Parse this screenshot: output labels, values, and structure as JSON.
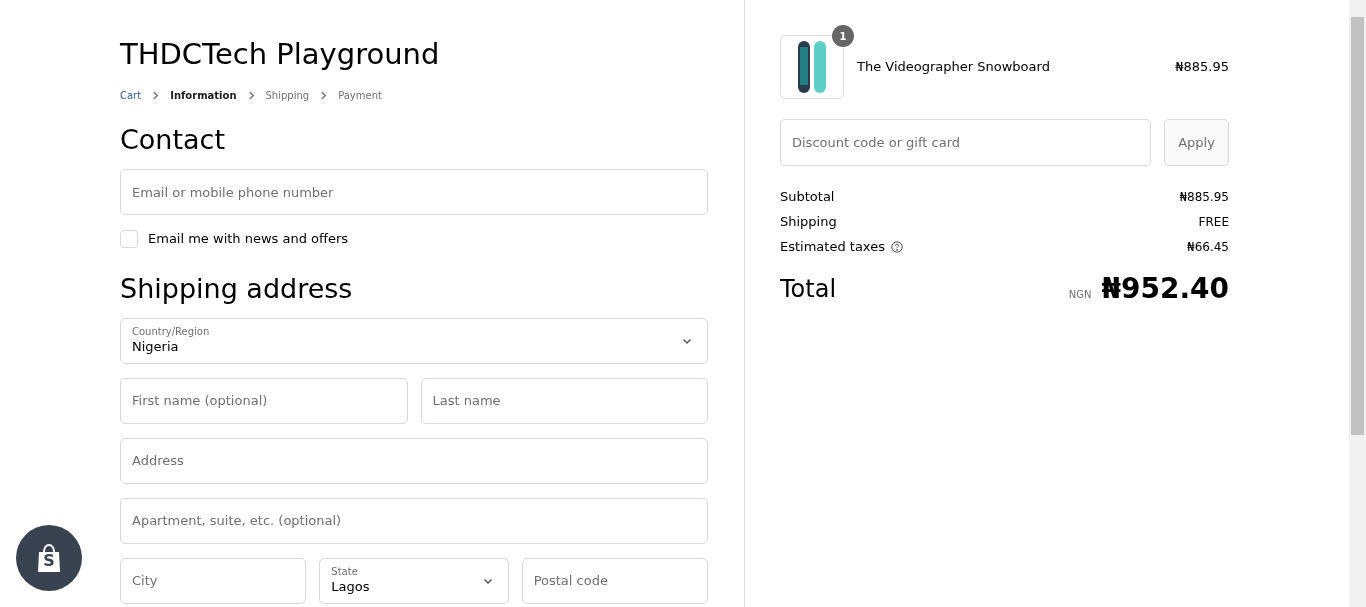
{
  "store": {
    "title": "THDCTech Playground"
  },
  "breadcrumbs": [
    {
      "label": "Cart",
      "selected": false,
      "link": true
    },
    {
      "label": "Information",
      "selected": true,
      "link": false
    },
    {
      "label": "Shipping",
      "selected": false,
      "link": false
    },
    {
      "label": "Payment",
      "selected": false,
      "link": false
    }
  ],
  "contact": {
    "heading": "Contact",
    "email": {
      "placeholder": "Email or mobile phone number"
    },
    "newsletter": {
      "label": "Email me with news and offers",
      "checked": false
    }
  },
  "shipping_address": {
    "heading": "Shipping address",
    "rows": [
      [
        {
          "kind": "select",
          "label": "Country/Region",
          "value": "Nigeria"
        }
      ],
      [
        {
          "kind": "input",
          "placeholder": "First name (optional)"
        },
        {
          "kind": "input",
          "placeholder": "Last name"
        }
      ],
      [
        {
          "kind": "input",
          "placeholder": "Address"
        }
      ],
      [
        {
          "kind": "input",
          "placeholder": "Apartment, suite, etc. (optional)"
        }
      ],
      [
        {
          "kind": "input",
          "placeholder": "City"
        },
        {
          "kind": "select",
          "label": "State",
          "value": "Lagos"
        },
        {
          "kind": "input",
          "placeholder": "Postal code"
        }
      ]
    ]
  },
  "summary": {
    "items": [
      {
        "name": "The Videographer Snowboard",
        "quantity": "1",
        "price": "₦885.95"
      }
    ],
    "discount": {
      "placeholder": "Discount code or gift card",
      "button": "Apply"
    },
    "lines": [
      {
        "label": "Subtotal",
        "value": "₦885.95",
        "info": false
      },
      {
        "label": "Shipping",
        "value": "FREE",
        "info": false
      },
      {
        "label": "Estimated taxes",
        "value": "₦66.45",
        "info": true
      }
    ],
    "total": {
      "label": "Total",
      "currency": "NGN",
      "value": "₦952.40"
    }
  },
  "shop_button": {
    "letter": "S"
  }
}
